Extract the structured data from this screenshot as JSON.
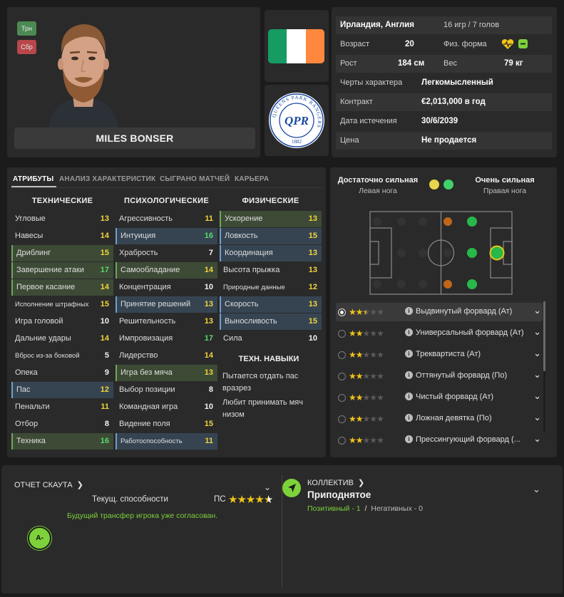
{
  "player": {
    "name": "MILES BONSER",
    "chips": [
      {
        "label": "Трн",
        "color": "#4c8a53"
      },
      {
        "label": "Сбр",
        "color": "#b8474b"
      }
    ],
    "flag_colors": [
      "#169b62",
      "#ffffff",
      "#ff883e"
    ],
    "club_badge": {
      "ring_text": "QUEENS PARK RANGERS",
      "year": "1882",
      "monogram": "QPR"
    }
  },
  "info": {
    "nation": "Ирландия, Англия",
    "caps": "16 игр / 7 голов",
    "age_label": "Возраст",
    "age": "20",
    "fitness_label": "Физ. форма",
    "height_label": "Рост",
    "height": "184 см",
    "weight_label": "Вес",
    "weight": "79 кг",
    "personality_label": "Черты характера",
    "personality": "Легкомысленный",
    "contract_label": "Контракт",
    "contract": "€2,013,000 в год",
    "expiry_label": "Дата истечения",
    "expiry": "30/6/2039",
    "price_label": "Цена",
    "price": "Не продается"
  },
  "tabs": [
    "АТРИБУТЫ",
    "АНАЛИЗ ХАРАКТЕРИСТИК",
    "СЫГРАНО МАТЧЕЙ",
    "КАРЬЕРА"
  ],
  "attributes": {
    "technical_title": "ТЕХНИЧЕСКИЕ",
    "mental_title": "ПСИХОЛОГИЧЕСКИЕ",
    "physical_title": "ФИЗИЧЕСКИЕ",
    "technical": [
      {
        "name": "Угловые",
        "value": "13",
        "hl": ""
      },
      {
        "name": "Навесы",
        "value": "14",
        "hl": ""
      },
      {
        "name": "Дриблинг",
        "value": "15",
        "hl": "green"
      },
      {
        "name": "Завершение атаки",
        "value": "17",
        "hl": "green"
      },
      {
        "name": "Первое касание",
        "value": "14",
        "hl": "green"
      },
      {
        "name": "Исполнение штрафных",
        "value": "15",
        "hl": "",
        "small": true
      },
      {
        "name": "Игра головой",
        "value": "10",
        "hl": ""
      },
      {
        "name": "Дальние удары",
        "value": "14",
        "hl": ""
      },
      {
        "name": "Вброс из-за боковой",
        "value": "5",
        "hl": "",
        "small": true
      },
      {
        "name": "Опека",
        "value": "9",
        "hl": ""
      },
      {
        "name": "Пас",
        "value": "12",
        "hl": "blue"
      },
      {
        "name": "Пенальти",
        "value": "11",
        "hl": ""
      },
      {
        "name": "Отбор",
        "value": "8",
        "hl": ""
      },
      {
        "name": "Техника",
        "value": "16",
        "hl": "green"
      }
    ],
    "mental": [
      {
        "name": "Агрессивность",
        "value": "11",
        "hl": ""
      },
      {
        "name": "Интуиция",
        "value": "16",
        "hl": "blue"
      },
      {
        "name": "Храбрость",
        "value": "7",
        "hl": ""
      },
      {
        "name": "Самообладание",
        "value": "14",
        "hl": "green"
      },
      {
        "name": "Концентрация",
        "value": "10",
        "hl": ""
      },
      {
        "name": "Принятие решений",
        "value": "13",
        "hl": "blue"
      },
      {
        "name": "Решительность",
        "value": "13",
        "hl": ""
      },
      {
        "name": "Импровизация",
        "value": "17",
        "hl": ""
      },
      {
        "name": "Лидерство",
        "value": "14",
        "hl": ""
      },
      {
        "name": "Игра без мяча",
        "value": "13",
        "hl": "green"
      },
      {
        "name": "Выбор позиции",
        "value": "8",
        "hl": ""
      },
      {
        "name": "Командная игра",
        "value": "10",
        "hl": ""
      },
      {
        "name": "Видение поля",
        "value": "15",
        "hl": ""
      },
      {
        "name": "Работоспособность",
        "value": "11",
        "hl": "blue",
        "small": true
      }
    ],
    "physical": [
      {
        "name": "Ускорение",
        "value": "13",
        "hl": "green"
      },
      {
        "name": "Ловкость",
        "value": "15",
        "hl": "blue"
      },
      {
        "name": "Координация",
        "value": "13",
        "hl": "blue"
      },
      {
        "name": "Высота прыжка",
        "value": "13",
        "hl": ""
      },
      {
        "name": "Природные данные",
        "value": "12",
        "hl": "",
        "small": true
      },
      {
        "name": "Скорость",
        "value": "13",
        "hl": "blue"
      },
      {
        "name": "Выносливость",
        "value": "15",
        "hl": "blue"
      },
      {
        "name": "Сила",
        "value": "10",
        "hl": ""
      }
    ],
    "traits_title": "ТЕХН. НАВЫКИ",
    "traits": [
      "Пытается отдать пас вразрез",
      "Любит принимать мяч низом"
    ]
  },
  "feet": {
    "left_title": "Достаточно сильная",
    "left_sub": "Левая нога",
    "left_color": "#e8d54a",
    "right_title": "Очень сильная",
    "right_sub": "Правая нога",
    "right_color": "#3fd26a"
  },
  "pitch_icon": "football-pitch-diagram",
  "roles": [
    {
      "name": "Выдвинутый форвард (Ат)",
      "stars": 2.5,
      "selected": true
    },
    {
      "name": "Универсальный форвард (Ат)",
      "stars": 2,
      "selected": false
    },
    {
      "name": "Треквартиста (Ат)",
      "stars": 2,
      "selected": false
    },
    {
      "name": "Оттянутый форвард (По)",
      "stars": 2,
      "selected": false
    },
    {
      "name": "Чистый форвард (Ат)",
      "stars": 2,
      "selected": false
    },
    {
      "name": "Ложная девятка (По)",
      "stars": 2,
      "selected": false
    },
    {
      "name": "Прессингующий форвард (...",
      "stars": 2,
      "selected": false
    }
  ],
  "scout": {
    "title": "ОТЧЕТ СКАУТА",
    "ability_label": "Текущ. способности",
    "ps_label": "ПС",
    "stars": 4.5,
    "note": "Будущий трансфер игрока уже согласован.",
    "grade": "A-"
  },
  "team": {
    "title": "КОЛЛЕКТИВ",
    "mood": "Приподнятое",
    "positive": "Позитивный - 1",
    "sep": "/",
    "negative": "Негативных - 0"
  },
  "colors": {
    "accent_green": "#7dd13a",
    "highlight_yellow": "#f0d43a",
    "star": "#f0c419"
  }
}
